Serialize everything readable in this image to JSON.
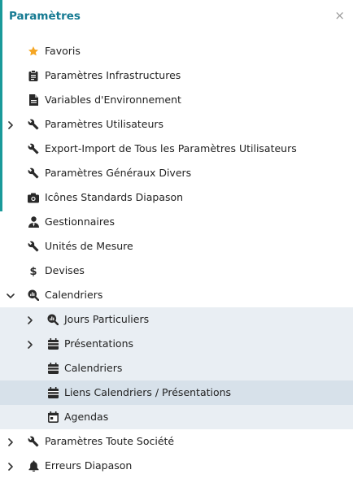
{
  "header": {
    "title": "Paramètres",
    "close": "×"
  },
  "tree": [
    {
      "label": "Favoris",
      "icon": "star-icon"
    },
    {
      "label": "Paramètres Infrastructures",
      "icon": "clipboard-icon"
    },
    {
      "label": "Variables d'Environnement",
      "icon": "file-icon"
    },
    {
      "label": "Paramètres Utilisateurs",
      "icon": "wrench-icon",
      "chevron": "right"
    },
    {
      "label": "Export-Import de Tous les Paramètres Utilisateurs",
      "icon": "wrench-icon"
    },
    {
      "label": "Paramètres Généraux Divers",
      "icon": "wrench-icon"
    },
    {
      "label": "Icônes Standards Diapason",
      "icon": "camera-icon"
    },
    {
      "label": "Gestionnaires",
      "icon": "user-tie-icon"
    },
    {
      "label": "Unités de Mesure",
      "icon": "wrench-icon"
    },
    {
      "label": "Devises",
      "icon": "dollar-icon"
    },
    {
      "label": "Calendriers",
      "icon": "search-chart-icon",
      "chevron": "down"
    },
    {
      "label": "Jours Particuliers",
      "icon": "search-chart-icon",
      "chevron": "right",
      "child": true
    },
    {
      "label": "Présentations",
      "icon": "calendar-list-icon",
      "chevron": "right",
      "child": true
    },
    {
      "label": "Calendriers",
      "icon": "calendar-list-icon",
      "child": true
    },
    {
      "label": "Liens Calendriers / Présentations",
      "icon": "calendar-list-icon",
      "child": true,
      "selected": true
    },
    {
      "label": "Agendas",
      "icon": "calendar-day-icon",
      "child": true
    },
    {
      "label": "Paramètres Toute Société",
      "icon": "wrench-icon",
      "chevron": "right"
    },
    {
      "label": "Erreurs Diapason",
      "icon": "bell-icon",
      "chevron": "right"
    }
  ],
  "colors": {
    "title": "#157a92",
    "accent_border": "#1a9a9a",
    "star": "#f5a623",
    "child_bg": "#e9eef3",
    "selected_bg": "#d7e1ea"
  }
}
